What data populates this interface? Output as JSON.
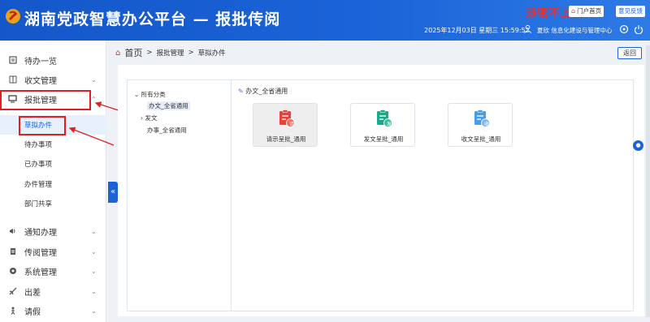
{
  "header": {
    "title": "湖南党政智慧办公平台 — 报批传阅",
    "watermark": "涉密不上网",
    "portal_label": "门户首页",
    "feedback_label": "意见反馈",
    "datetime": "2025年12月03日 星期三 15:59:52",
    "user": "夏欣  信息化建设与管理中心"
  },
  "sidebar": {
    "items": [
      {
        "label": "待办一览",
        "icon": "list-icon"
      },
      {
        "label": "收文管理",
        "icon": "inbox-icon",
        "arrow": "⌄"
      },
      {
        "label": "报批管理",
        "icon": "monitor-icon",
        "arrow": "⌃"
      },
      {
        "label": "通知办理",
        "icon": "megaphone-icon",
        "arrow": "⌄"
      },
      {
        "label": "传阅管理",
        "icon": "document-icon",
        "arrow": "⌄"
      },
      {
        "label": "系统管理",
        "icon": "settings-icon",
        "arrow": "⌄"
      },
      {
        "label": "出差",
        "icon": "plane-icon",
        "arrow": "⌄"
      },
      {
        "label": "请假",
        "icon": "person-icon",
        "arrow": "⌄"
      }
    ],
    "sub_items": [
      "草拟办件",
      "待办事项",
      "已办事项",
      "办件管理",
      "部门共享"
    ]
  },
  "breadcrumb": {
    "home": "首页",
    "sep": ">",
    "level1": "报批管理",
    "level2": "草拟办件"
  },
  "back_label": "返回",
  "tree": {
    "root": "所有分类",
    "children": [
      "办文_全省通用",
      "发文",
      "办事_全省通用"
    ]
  },
  "category_title": "办文_全省通用",
  "cards": [
    {
      "label": "请示呈批_通用",
      "badge": "请",
      "color": "#e8413a"
    },
    {
      "label": "发文呈批_通用",
      "badge": "发",
      "color": "#1aa88a"
    },
    {
      "label": "收文呈批_通用",
      "badge": "收",
      "color": "#4a9be8"
    }
  ],
  "colors": {
    "brand": "#1a63d8",
    "highlight": "#e02020"
  }
}
